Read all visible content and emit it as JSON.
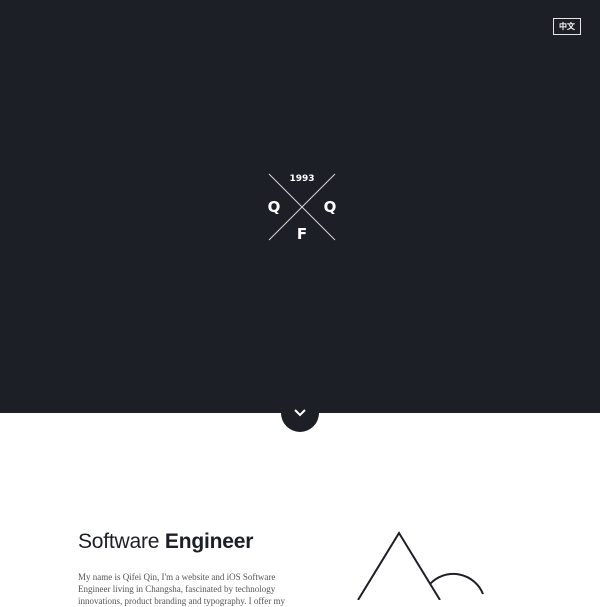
{
  "header": {
    "language_toggle": "中文"
  },
  "logo": {
    "year": "1993",
    "letter_left": "Q",
    "letter_right": "Q",
    "letter_bottom": "F"
  },
  "scroll_down": {
    "icon": "chevron-down-icon"
  },
  "about": {
    "title_regular": "Software",
    "title_bold": "Engineer",
    "paragraph": "My name is Qifei Qin, I'm a website and iOS Software Engineer living in Changsha, fascinated by technology innovations, product branding and typography. I offer my"
  },
  "illustration": {
    "icon": "triangle-circle-icon"
  },
  "colors": {
    "hero_background": "#1d1f27",
    "page_background": "#ffffff",
    "text_dark": "#1d1f27",
    "text_body": "#555555"
  }
}
